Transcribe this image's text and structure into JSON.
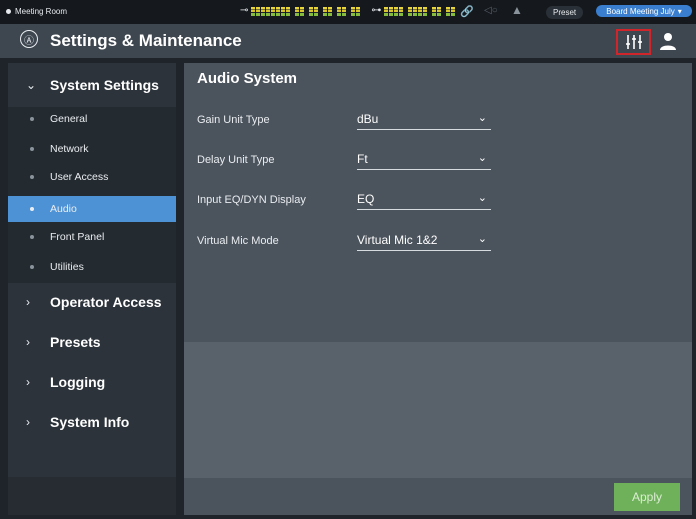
{
  "status_bar": {
    "room_name": "Meeting Room",
    "input_meter_icon": "input-level-icon",
    "output_meter_icon": "output-level-icon",
    "link_icon": "link-icon",
    "preset_label": "Preset",
    "preset_name": "Board Meeting July"
  },
  "header": {
    "title": "Settings & Maintenance",
    "logo_glyph": "Ⓐ"
  },
  "sidebar": {
    "sections": [
      {
        "label": "System Settings",
        "expanded": true
      },
      {
        "label": "Operator Access",
        "expanded": false
      },
      {
        "label": "Presets",
        "expanded": false
      },
      {
        "label": "Logging",
        "expanded": false
      },
      {
        "label": "System Info",
        "expanded": false
      }
    ],
    "system_settings_items": [
      {
        "label": "General"
      },
      {
        "label": "Network"
      },
      {
        "label": "User Access"
      },
      {
        "label": "Audio",
        "active": true
      },
      {
        "label": "Front Panel"
      },
      {
        "label": "Utilities"
      }
    ]
  },
  "main": {
    "title": "Audio System",
    "rows": [
      {
        "label": "Gain Unit Type",
        "value": "dBu"
      },
      {
        "label": "Delay Unit Type",
        "value": "Ft"
      },
      {
        "label": "Input EQ/DYN Display",
        "value": "EQ"
      },
      {
        "label": "Virtual Mic Mode",
        "value": "Virtual Mic 1&2"
      }
    ],
    "apply_label": "Apply"
  },
  "colors": {
    "accent": "#4e92d6",
    "apply": "#6fb05a",
    "highlight_border": "#d0262b"
  }
}
